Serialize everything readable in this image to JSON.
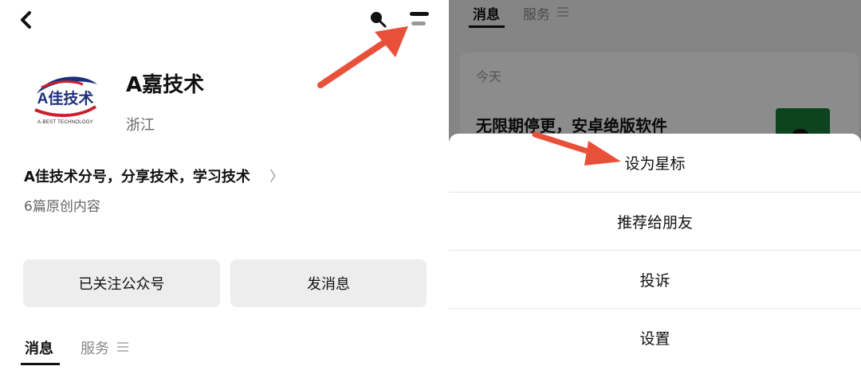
{
  "profile": {
    "name": "A嘉技术",
    "region": "浙江",
    "logo_text": "A佳技术",
    "logo_subtext": "A-BEST TECHNOLOGY",
    "description": "A佳技术分号，分享技术，学习技术",
    "article_count": "6篇原创内容"
  },
  "actions": {
    "follow_label": "已关注公众号",
    "message_label": "发消息"
  },
  "tabs": {
    "messages": "消息",
    "services": "服务"
  },
  "feed": {
    "date_header": "今天",
    "article_title": "无限期停更，安卓绝版软件"
  },
  "menu_sheet": {
    "items": [
      "设为星标",
      "推荐给朋友",
      "投诉",
      "设置"
    ]
  },
  "icons": {
    "back": "chevron-left-icon",
    "search": "search-icon",
    "menu": "menu-icon",
    "more_tabs": "list-icon"
  },
  "colors": {
    "annotation_arrow": "#e8503a",
    "button_bg": "#ededed",
    "thumbnail": "#1a7a3a"
  }
}
